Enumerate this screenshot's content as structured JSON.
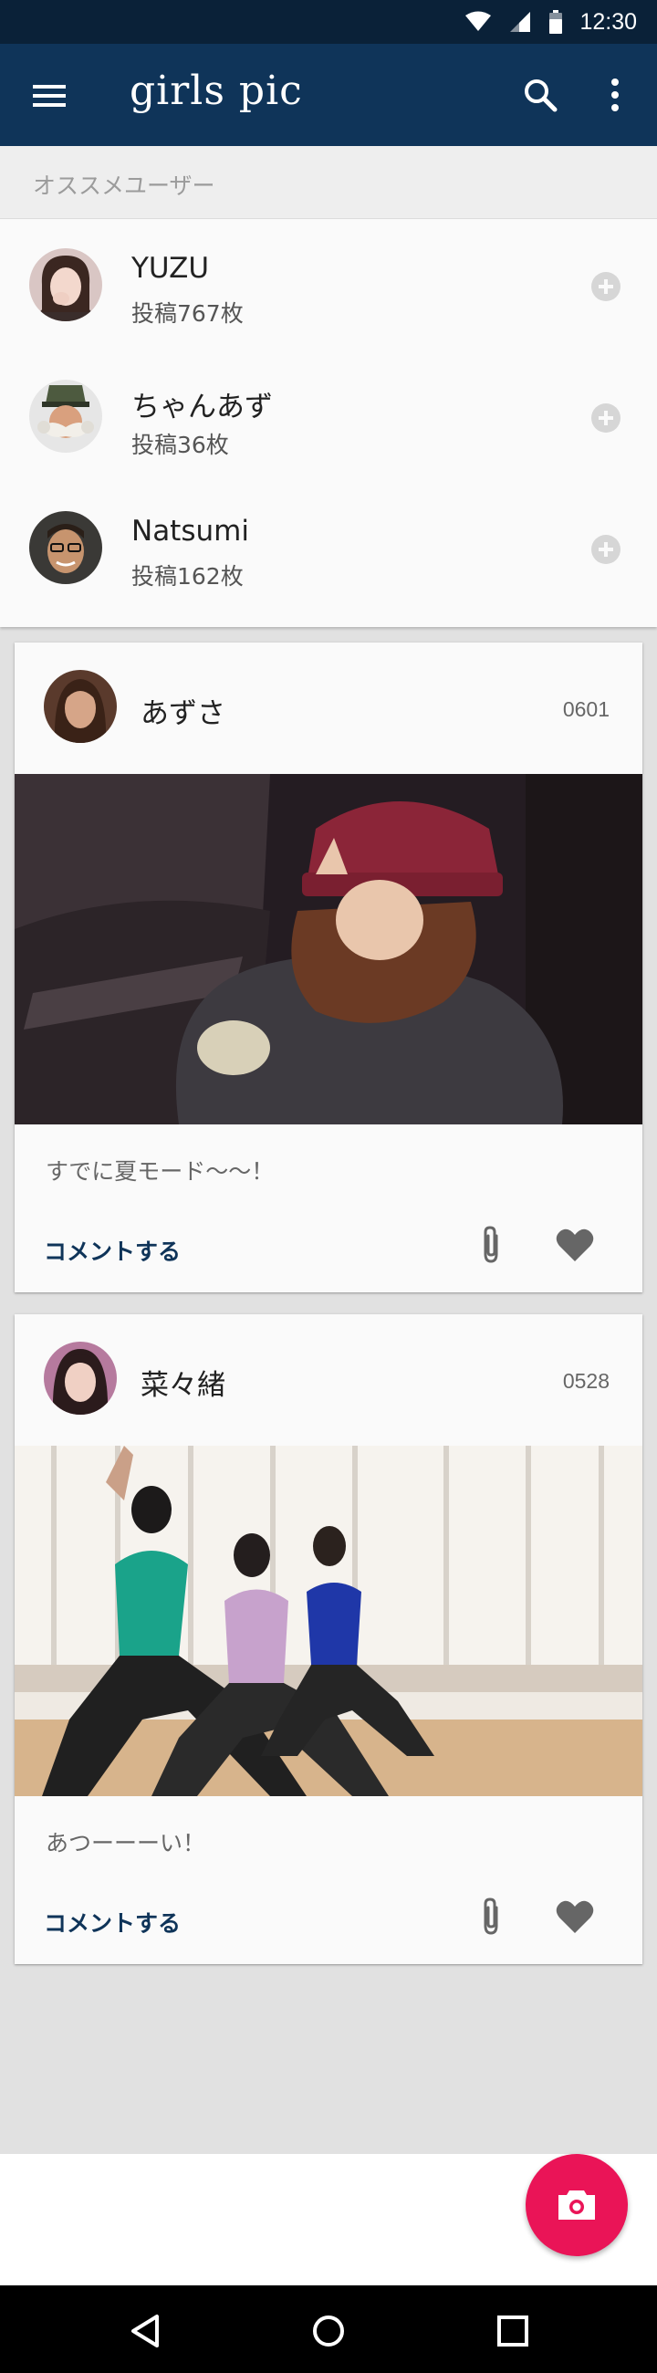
{
  "status_bar": {
    "time": "12:30"
  },
  "app_bar": {
    "title": "girls pic"
  },
  "recommended": {
    "header": "オススメユーザー",
    "users": [
      {
        "name": "YUZU",
        "posts": "投稿767枚"
      },
      {
        "name": "ちゃんあず",
        "posts": "投稿36枚"
      },
      {
        "name": "Natsumi",
        "posts": "投稿162枚"
      }
    ]
  },
  "posts": [
    {
      "user": "あずさ",
      "date": "0601",
      "caption": "すでに夏モード〜〜！",
      "comment_label": "コメントする"
    },
    {
      "user": "菜々緒",
      "date": "0528",
      "caption": "あつーーーい！",
      "comment_label": "コメントする"
    }
  ],
  "colors": {
    "app_bar": "#0f3459",
    "status_bar": "#0a2138",
    "fab": "#ea1457",
    "comment_link": "#0f3459"
  },
  "icons": [
    "menu-icon",
    "search-icon",
    "more-vert-icon",
    "add-circle-icon",
    "attachment-icon",
    "heart-icon",
    "camera-icon",
    "back-icon",
    "home-icon",
    "recents-icon"
  ]
}
